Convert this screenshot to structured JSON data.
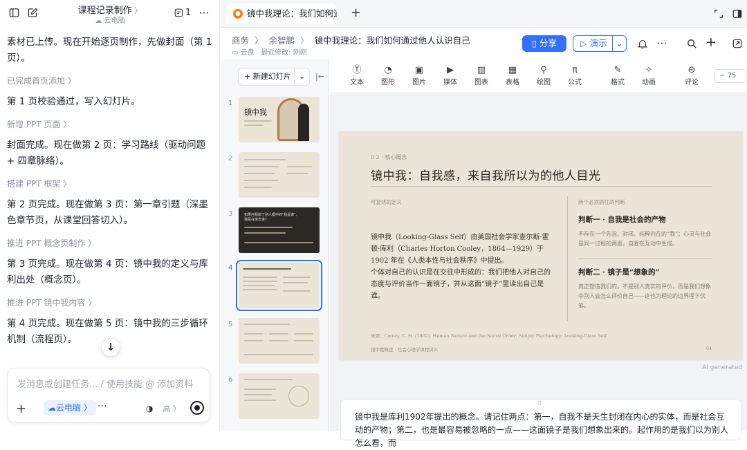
{
  "chat": {
    "title": "课程记录制作",
    "subtitle": "云电脑",
    "thread_count": "1",
    "messages": [
      {
        "kind": "msg",
        "text": "素材已上传。现在开始逐页制作，先做封面（第 1 页）。"
      },
      {
        "kind": "step",
        "text": "已完成首页添加"
      },
      {
        "kind": "msg",
        "text": "第 1 页校验通过，写入幻灯片。"
      },
      {
        "kind": "step",
        "text": "新增 PPT 页面"
      },
      {
        "kind": "msg",
        "text": "封面完成。现在做第 2 页：学习路线（驱动问题 + 四章脉络）。"
      },
      {
        "kind": "step",
        "text": "搭建 PPT 框架"
      },
      {
        "kind": "msg",
        "text": "第 2 页完成。现在做第 3 页：第一章引题（深墨色章节页，从课堂回答切入）。"
      },
      {
        "kind": "step",
        "text": "推进 PPT 概念页制作"
      },
      {
        "kind": "msg",
        "text": "第 3 页完成。现在做第 4 页：镜中我的定义与库利出处（概念页）。"
      },
      {
        "kind": "step",
        "text": "推进 PPT 镜中我内容"
      },
      {
        "kind": "msg",
        "text": "第 4 页完成。现在做第 5 页：镜中我的三步循环机制（流程页）。"
      }
    ],
    "composer": {
      "placeholder": "发消息或创建任务... / 使用技能 @ 添加资料",
      "cloud_chip": "云电脑",
      "mode": "高"
    }
  },
  "tab": {
    "title": "镜中我理论：我们如何通过他人认识自己"
  },
  "doc": {
    "breadcrumbs": [
      "商务",
      "余智鹏",
      "镜中我理论：我们如何通过他人认识自己"
    ],
    "location": "云盘",
    "modified": "最近修改: 刚刚",
    "share_label": "分享",
    "present_label": "演示"
  },
  "slides_panel": {
    "new_slide_label": "新建幻灯片",
    "numbers": [
      "1",
      "2",
      "3",
      "4",
      "5",
      "6"
    ],
    "selected": 4,
    "thumb1_title": "镜中我",
    "thumb3_title": "如果自我能了别人眼中的\"我是谁\"，\n我是在谁去谁？"
  },
  "toolbar": {
    "tools": [
      "文本",
      "图形",
      "图片",
      "媒体",
      "图表",
      "表格",
      "绘图",
      "公式",
      "格式",
      "动画",
      "评论"
    ],
    "zoom": "75"
  },
  "slide": {
    "kicker": "0 2 · 核心概念",
    "title": "镜中我：自我感，来自我所以为的他人目光",
    "left_head": "可复述的定义",
    "body1": "镜中我（Looking-Glass Self）由美国社会学家查尔斯·霍顿·库利（Charles Horton Cooley，1864—1929）于 1902 年在《人类本性与社会秩序》中提出。",
    "body2": "个体对自己的认识是在交往中形成的：我们把他人对自己的态度与评价当作一面镜子，并从这面“镜子”里读出自己是谁。",
    "right_head": "两个必须抓住的判断",
    "judgment1_title": "判断一 · 自我是社会的产物",
    "judgment1_text": "不存在一个先验、封闭、纯粹内在的“我”；心灵与社会是同一过程的两面，自我在互动中生成。",
    "judgment2_title": "判断二 · 镜子是“想象的”",
    "judgment2_text": "真正塑造我们的，不是别人真实的评价，而是我们想象中别人会怎么评价自己——这也为理论的边界埋下伏笔。",
    "source": "来源：Cooley, C. H. (1902). Human Nature and the Social Order; Simply Psychology: Looking-Glass Self",
    "footer": "镜中我概述 · 社会心理学课程讲义",
    "page": "04"
  },
  "ai_generated": "AI generated",
  "notes": {
    "text": "镜中我是库利1902年提出的概念。请记住两点：第一，自我不是天生封闭在内心的实体，而是社会互动的产物；第二，也是最容易被忽略的一点——这面镜子是我们想象出来的。起作用的是我们以为别人怎么看，而"
  }
}
